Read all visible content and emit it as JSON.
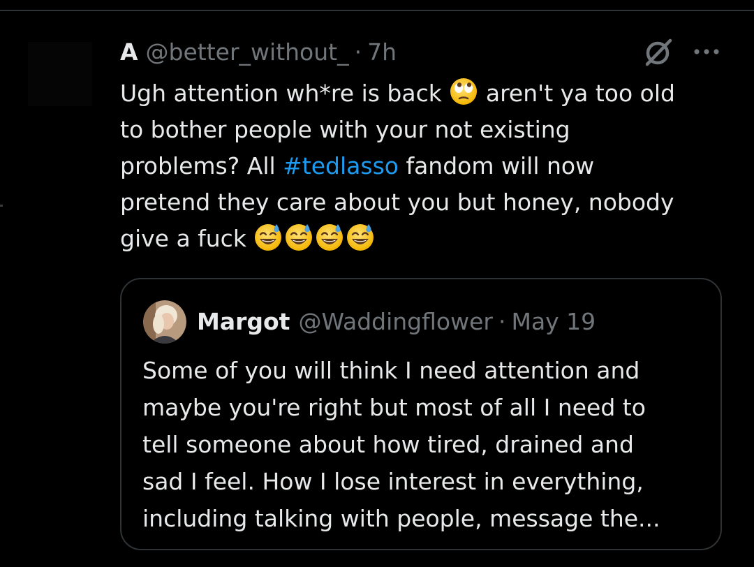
{
  "tweet": {
    "author": {
      "display_name": "A",
      "handle": "@better_without_",
      "separator": "·",
      "time": "7h"
    },
    "icons": {
      "grok": "grok-slash-circle-icon",
      "more": "more-options-icon"
    },
    "text": {
      "line1_a": "Ugh attention wh*re is back",
      "line1_b": "aren't ya too old",
      "line2": "to bother people with your not existing",
      "line3_a": "problems? All",
      "hashtag": "#tedlasso",
      "line3_b": "fandom will now",
      "line4": "pretend they care about you but honey, nobody",
      "line5": "give a fuck"
    },
    "emoji": {
      "rolling_eyes": "face-with-rolling-eyes",
      "sweat_smile_count": "4",
      "sweat_smile": "grinning-face-with-sweat"
    }
  },
  "quote": {
    "author": {
      "display_name": "Margot",
      "handle": "@Waddingflower",
      "separator": "·",
      "date": "May 19"
    },
    "text": {
      "line1": "Some of you will think I need attention and",
      "line2": "maybe you're right but most of all I need to",
      "line3": "tell someone about how tired, drained and",
      "line4": "sad I feel. How I lose interest in everything,",
      "line5": "including talking with people, message the..."
    }
  },
  "colors": {
    "background": "#000000",
    "text_primary": "#e7e9ea",
    "text_secondary": "#71767b",
    "link": "#1d9bf0",
    "border": "#2f3336",
    "emoji_face": "#fbc02d",
    "emoji_sweat": "#4fa3e0"
  }
}
